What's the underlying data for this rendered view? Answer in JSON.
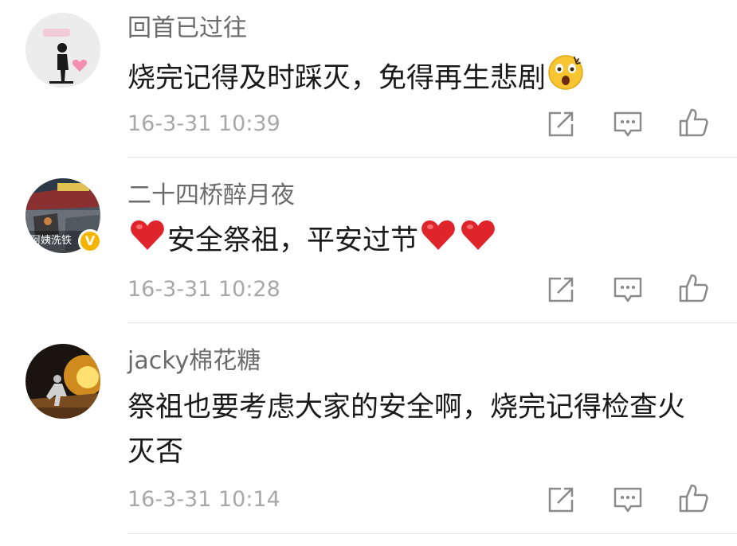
{
  "comments": [
    {
      "username": "回首已过往",
      "text_before": "烧完记得及时踩灭，免得再生悲剧",
      "emoji": "shocked-face-icon",
      "timestamp": "16-3-31 10:39",
      "avatar_label": "",
      "verified": false
    },
    {
      "username": "二十四桥醉月夜",
      "text_main": "安全祭祖，平安过节",
      "emoji": "red-heart-icon",
      "timestamp": "16-3-31 10:28",
      "avatar_label": "阿姨洗铁",
      "verified": true
    },
    {
      "username": "jacky棉花糖",
      "text_before": "祭祖也要考虑大家的安全啊，烧完记得检查火灭否",
      "timestamp": "16-3-31 10:14",
      "verified": false
    }
  ],
  "actions": {
    "share": "share-icon",
    "reply": "comment-icon",
    "like": "thumbs-up-icon"
  },
  "colors": {
    "username": "#6b6b6b",
    "text": "#1a1a1a",
    "timestamp": "#a8a8a8",
    "icon": "#8a8a8a",
    "heart": "#e0242b",
    "verified": "#f4b400"
  }
}
